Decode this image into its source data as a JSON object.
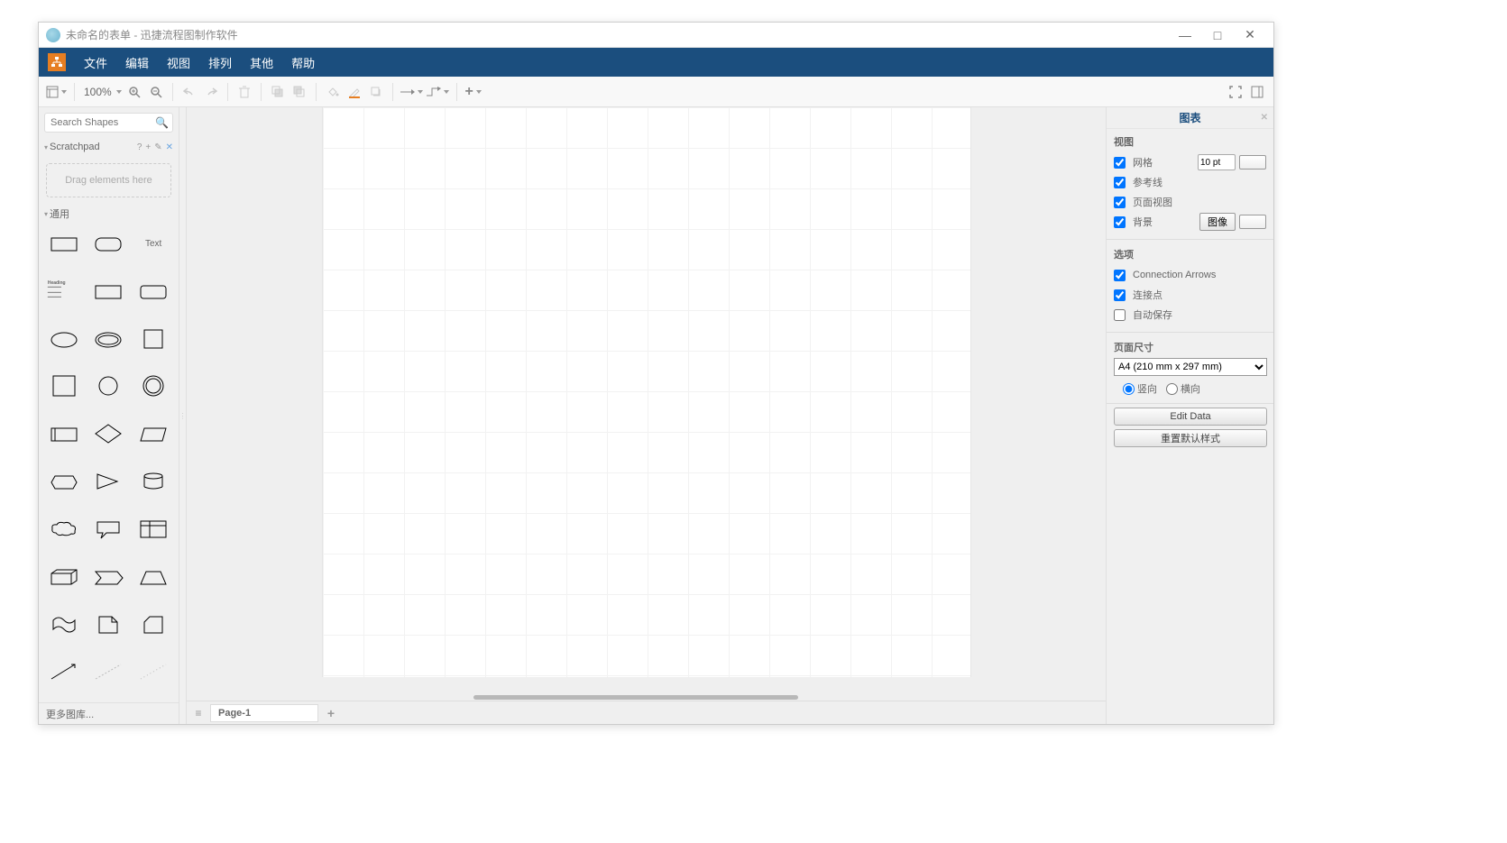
{
  "titlebar": {
    "text": "未命名的表单 - 迅捷流程图制作软件"
  },
  "menu": {
    "items": [
      "文件",
      "编辑",
      "视图",
      "排列",
      "其他",
      "帮助"
    ]
  },
  "toolbar": {
    "zoom": "100%"
  },
  "left": {
    "search_placeholder": "Search Shapes",
    "scratchpad_label": "Scratchpad",
    "drag_hint": "Drag elements here",
    "common_label": "通用",
    "text_label": "Text",
    "heading_label": "Heading",
    "more_shapes": "更多图库..."
  },
  "center": {
    "page_tab": "Page-1"
  },
  "right": {
    "title": "图表",
    "view_section": "视图",
    "grid": "网格",
    "grid_value": "10 pt",
    "guides": "参考线",
    "page_view": "页面视图",
    "background": "背景",
    "image_btn": "图像",
    "options_section": "选项",
    "conn_arrows": "Connection Arrows",
    "conn_points": "连接点",
    "autosave": "自动保存",
    "page_size_section": "页面尺寸",
    "page_size_value": "A4 (210 mm x 297 mm)",
    "portrait": "竖向",
    "landscape": "横向",
    "edit_data": "Edit Data",
    "reset_style": "重置默认样式"
  }
}
